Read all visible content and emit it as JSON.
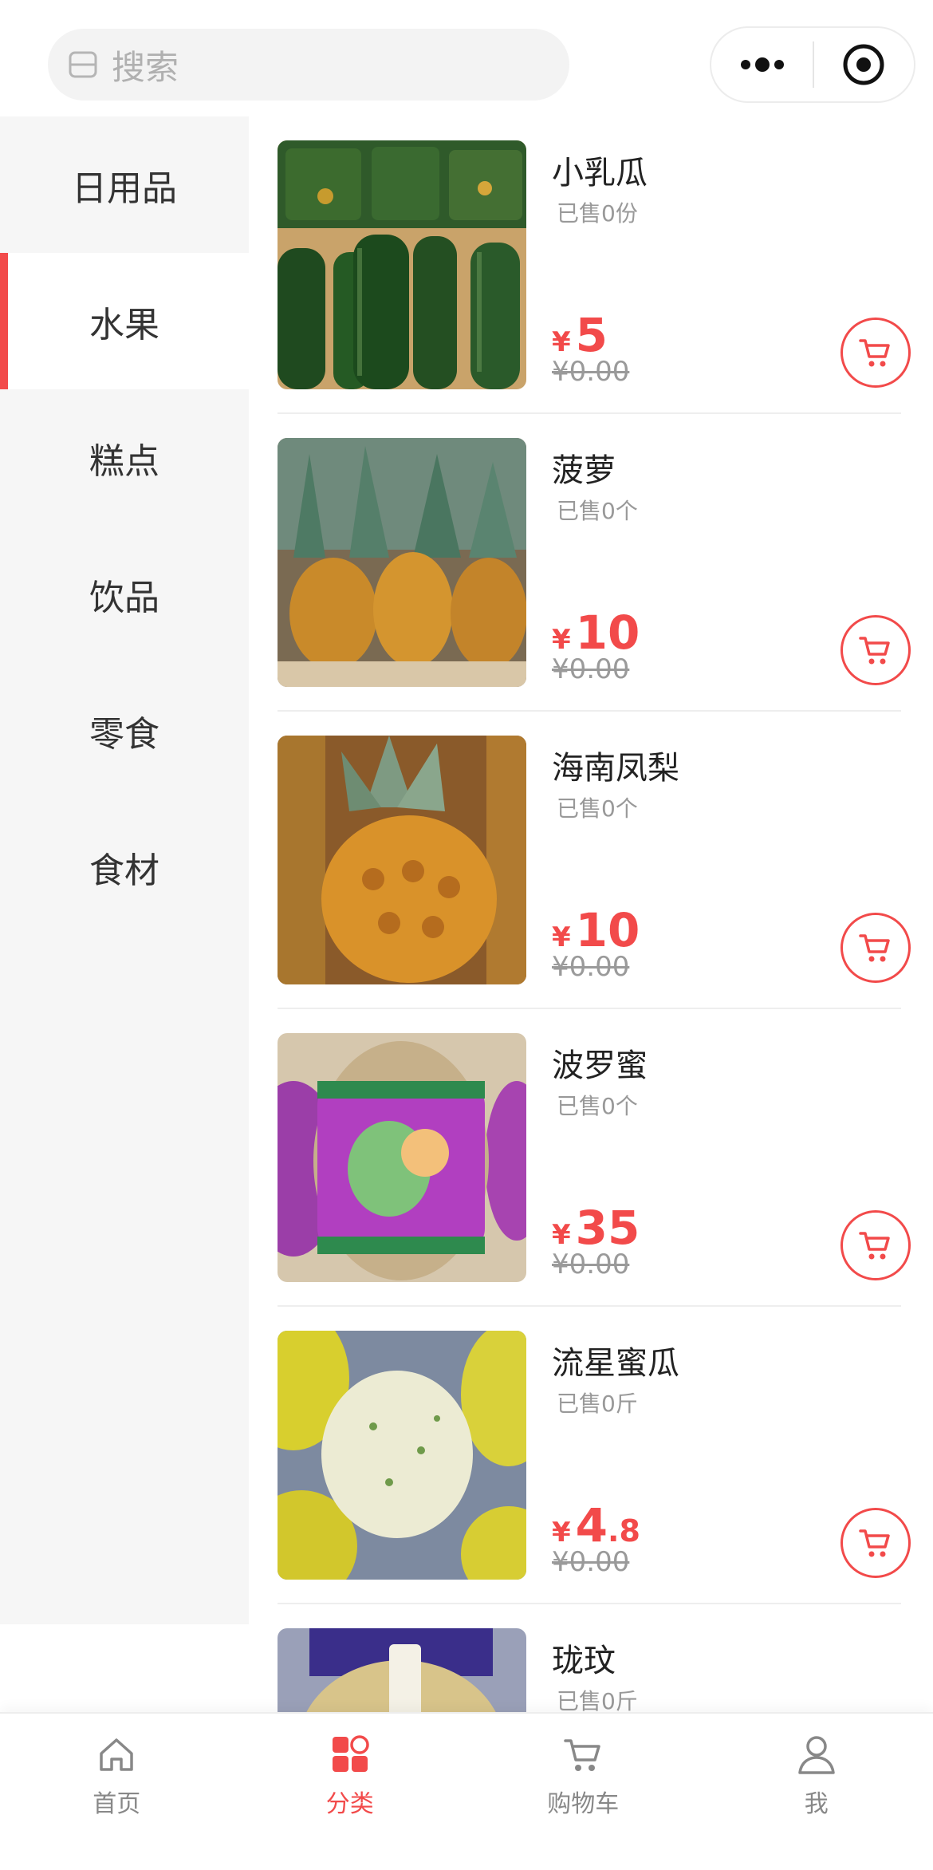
{
  "search": {
    "placeholder": "搜索"
  },
  "sidebar": {
    "items": [
      {
        "label": "日用品"
      },
      {
        "label": "水果"
      },
      {
        "label": "糕点"
      },
      {
        "label": "饮品"
      },
      {
        "label": "零食"
      },
      {
        "label": "食材"
      }
    ],
    "active_label": "水果"
  },
  "products": [
    {
      "name": "小乳瓜",
      "sold": "已售0份",
      "currency": "¥",
      "price": "5",
      "original_price": "¥0.00"
    },
    {
      "name": "菠萝",
      "sold": "已售0个",
      "currency": "¥",
      "price": "10",
      "original_price": "¥0.00"
    },
    {
      "name": "海南凤梨",
      "sold": "已售0个",
      "currency": "¥",
      "price": "10",
      "original_price": "¥0.00"
    },
    {
      "name": "波罗蜜",
      "sold": "已售0个",
      "currency": "¥",
      "price": "35",
      "original_price": "¥0.00"
    },
    {
      "name": "流星蜜瓜",
      "sold": "已售0斤",
      "currency": "¥",
      "price": "4.8",
      "original_price": "¥0.00"
    },
    {
      "name": "珑玟",
      "sold": "已售0斤",
      "currency": "¥",
      "price": "",
      "original_price": ""
    }
  ],
  "tabbar": {
    "items": [
      {
        "label": "首页",
        "icon": "home-icon"
      },
      {
        "label": "分类",
        "icon": "category-icon"
      },
      {
        "label": "购物车",
        "icon": "cart-icon"
      },
      {
        "label": "我",
        "icon": "user-icon"
      }
    ],
    "active_label": "分类"
  },
  "colors": {
    "accent": "#f24a4a",
    "sidebar_bg": "#f6f6f6",
    "muted_text": "#999999"
  }
}
